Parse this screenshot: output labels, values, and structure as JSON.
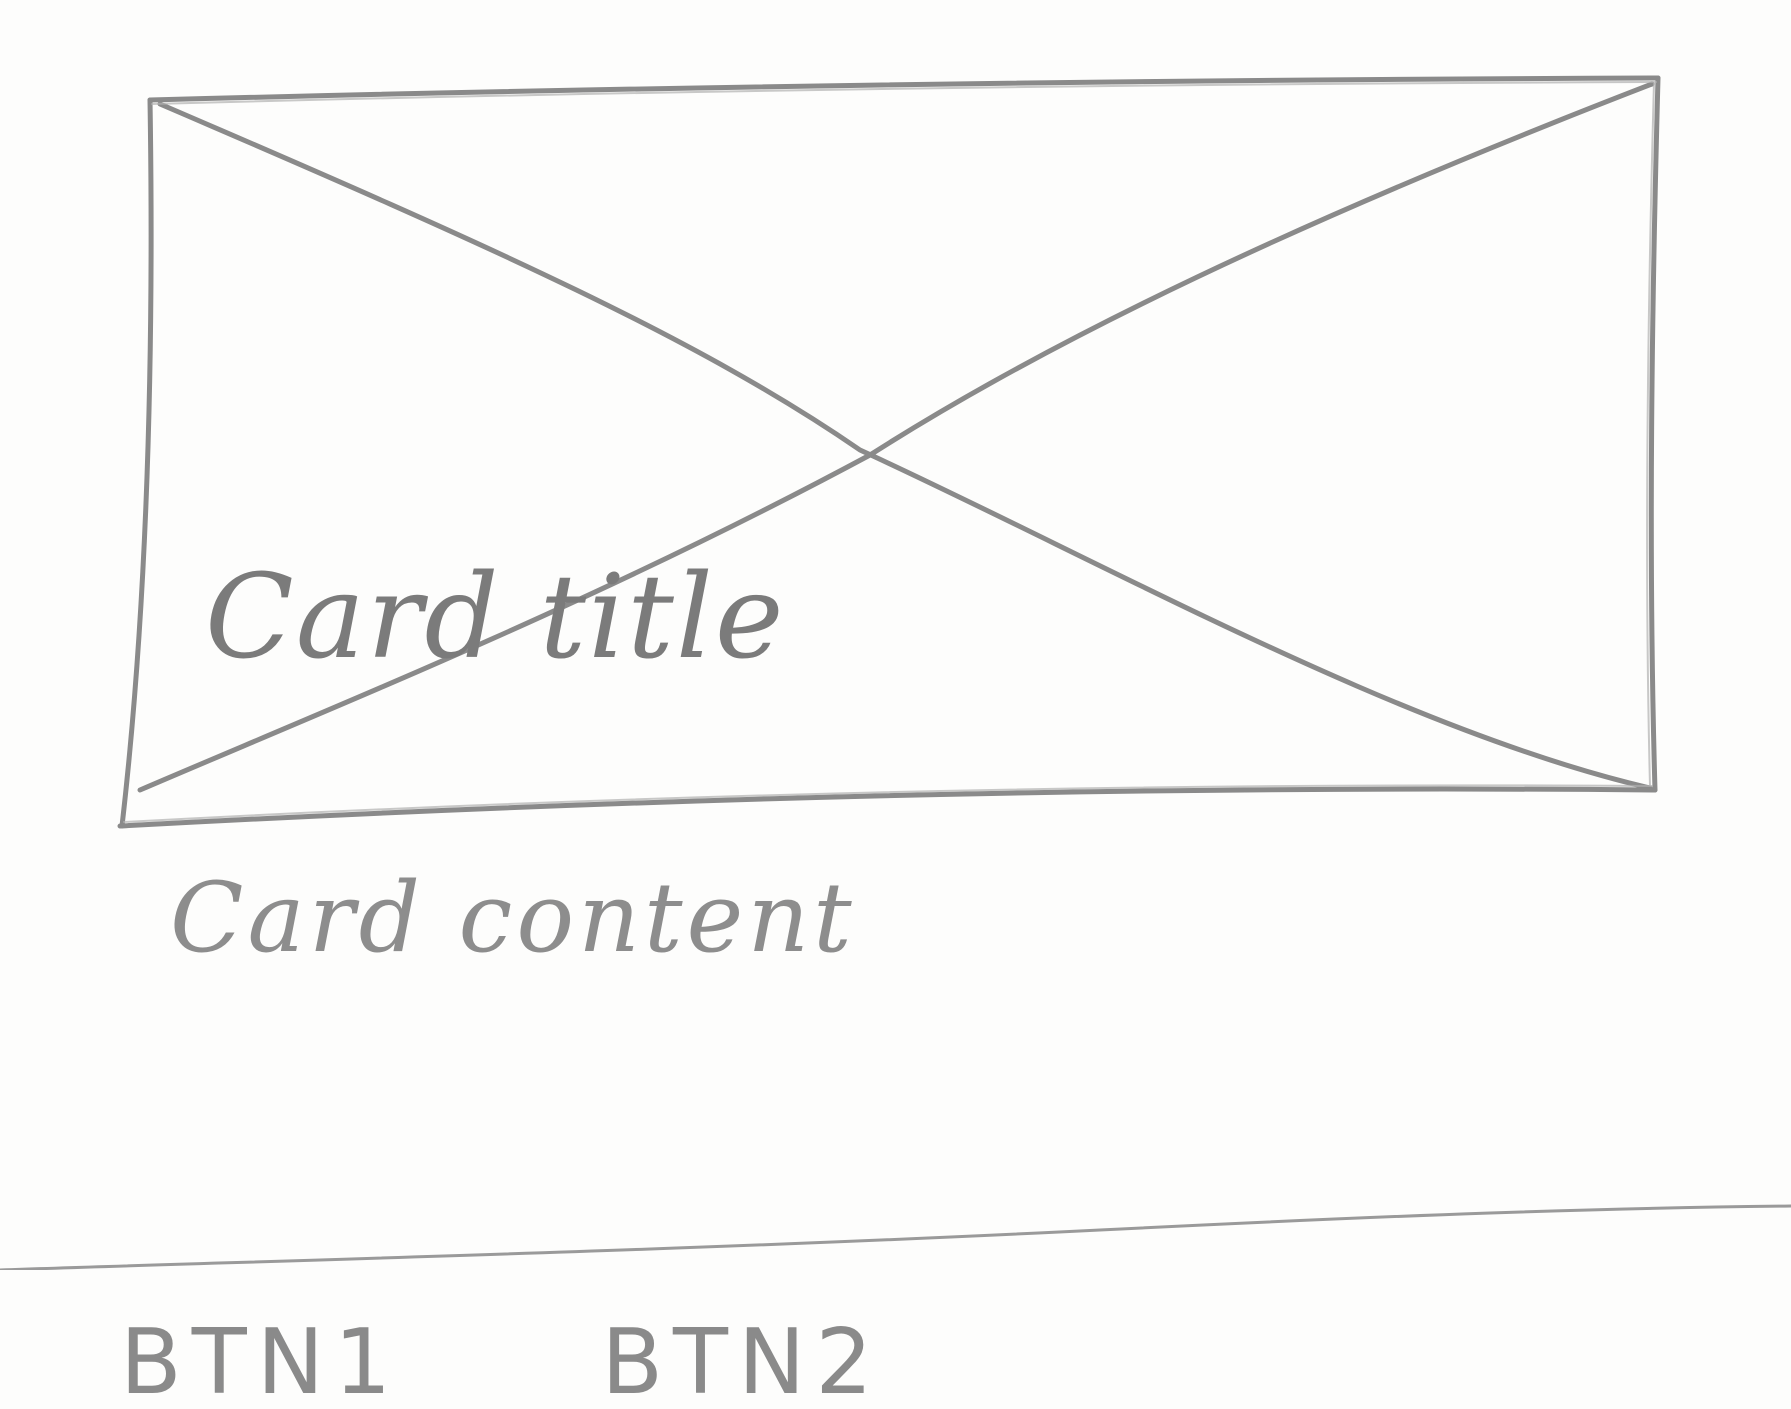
{
  "card": {
    "title": "Card title",
    "content": "Card content"
  },
  "actions": {
    "btn1_label": "BTN1",
    "btn2_label": "BTN2"
  },
  "colors": {
    "pencil": "#808080",
    "paper": "#fdfdfc"
  },
  "icons": {
    "image_placeholder": "image-placeholder-icon"
  }
}
